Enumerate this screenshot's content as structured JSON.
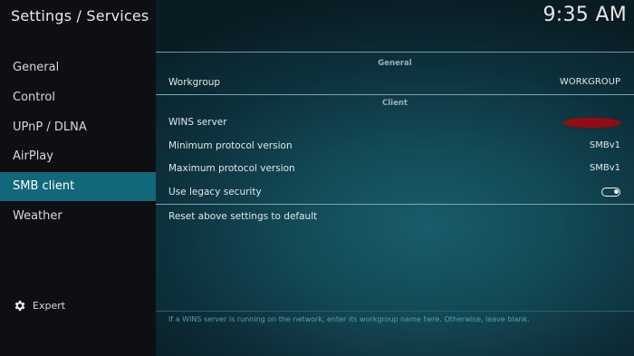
{
  "header": {
    "title": "Settings / Services",
    "time": "9:35 AM"
  },
  "sidebar": {
    "items": [
      {
        "label": "General"
      },
      {
        "label": "Control"
      },
      {
        "label": "UPnP / DLNA"
      },
      {
        "label": "AirPlay"
      },
      {
        "label": "SMB client",
        "selected": true
      },
      {
        "label": "Weather"
      }
    ],
    "settings_level": {
      "label": "Expert",
      "icon": "gear-icon"
    }
  },
  "panel": {
    "groups": [
      {
        "header": "General",
        "rows": [
          {
            "label": "Workgroup",
            "value": "WORKGROUP"
          }
        ]
      },
      {
        "header": "Client",
        "rows": [
          {
            "label": "WINS server",
            "value_redacted": true
          },
          {
            "label": "Minimum protocol version",
            "value": "SMBv1"
          },
          {
            "label": "Maximum protocol version",
            "value": "SMBv1"
          },
          {
            "label": "Use legacy security",
            "toggle_on": true
          }
        ]
      }
    ],
    "reset_label": "Reset above settings to default"
  },
  "help": {
    "text": "If a WINS server is running on the network, enter its workgroup name here. Otherwise, leave blank."
  },
  "colors": {
    "accent": "#12677a",
    "sidebar_bg": "#0d0f12",
    "redaction": "#8d0f15",
    "help_text": "#52a2b4"
  }
}
